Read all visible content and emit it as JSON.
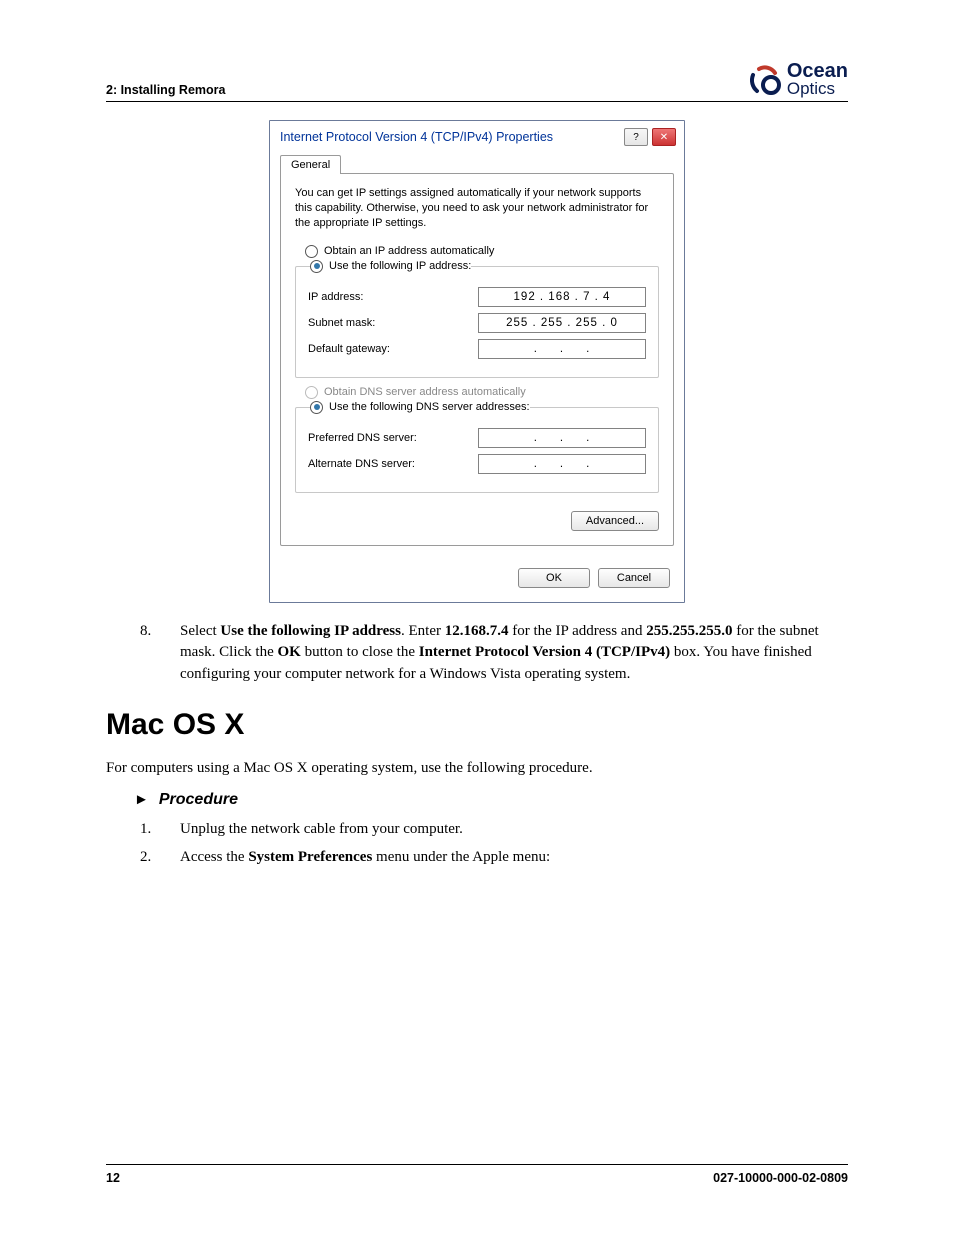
{
  "header": {
    "section_label": "2: Installing Remora"
  },
  "brand": {
    "top": "Ocean",
    "bottom": "Optics"
  },
  "dialog": {
    "title": "Internet Protocol Version 4 (TCP/IPv4) Properties",
    "tab": "General",
    "intro": "You can get IP settings assigned automatically if your network supports this capability. Otherwise, you need to ask your network administrator for the appropriate IP settings.",
    "radio_ip_auto": "Obtain an IP address automatically",
    "radio_ip_manual": "Use the following IP address:",
    "ip_label": "IP address:",
    "ip_value": "192 . 168 .  7  .  4",
    "subnet_label": "Subnet mask:",
    "subnet_value": "255 . 255 . 255 .  0",
    "gateway_label": "Default gateway:",
    "gateway_value": ".       .       .",
    "radio_dns_auto": "Obtain DNS server address automatically",
    "radio_dns_manual": "Use the following DNS server addresses:",
    "pref_dns_label": "Preferred DNS server:",
    "pref_dns_value": ".       .       .",
    "alt_dns_label": "Alternate DNS server:",
    "alt_dns_value": ".       .       .",
    "advanced": "Advanced...",
    "ok": "OK",
    "cancel": "Cancel"
  },
  "step8": {
    "num": "8.",
    "a": "Select ",
    "b": "Use the following IP address",
    "c": ". Enter ",
    "d": "12.168.7.4",
    "e": " for the IP address and ",
    "f": "255.255.255.0",
    "g": " for the subnet mask. Click the ",
    "h": "OK",
    "i": " button to close the ",
    "j": "Internet Protocol Version 4 (TCP/IPv4)",
    "k": " box. You have finished configuring your computer network for a Windows Vista operating system."
  },
  "heading": "Mac OS X",
  "intro_para": "For computers using a Mac OS X operating system, use the following procedure.",
  "procedure_label": "Procedure",
  "steps": [
    {
      "num": "1.",
      "text": "Unplug the network cable from your computer."
    },
    {
      "num": "2.",
      "a": "Access the ",
      "b": "System Preferences",
      "c": " menu under the Apple menu:"
    }
  ],
  "footer": {
    "page": "12",
    "docnum": "027-10000-000-02-0809"
  }
}
